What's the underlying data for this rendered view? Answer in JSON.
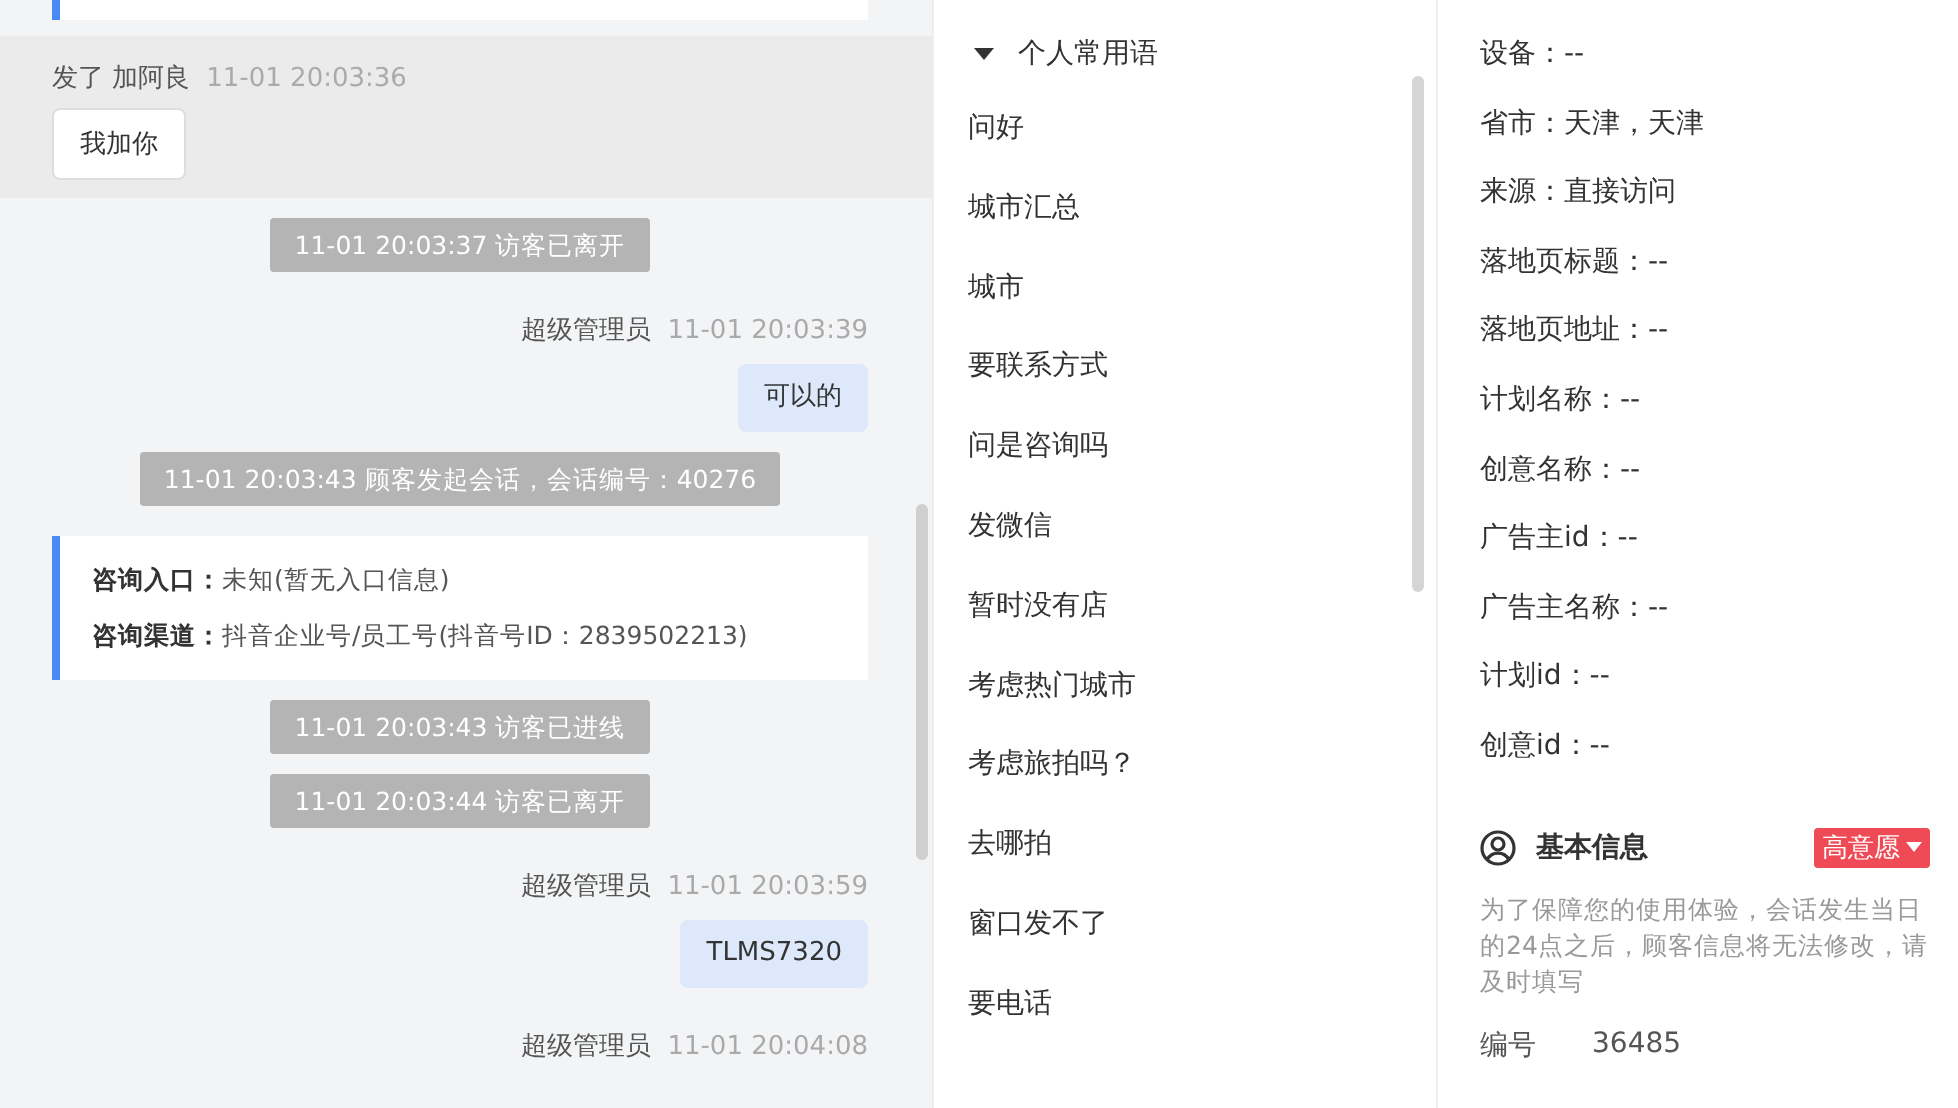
{
  "chat": {
    "messages": [
      {
        "kind": "clipped_card"
      },
      {
        "kind": "highlight",
        "sender": "发了 加阿良",
        "time": "11-01 20:03:36",
        "button": "我加你"
      },
      {
        "kind": "notice",
        "text": "11-01 20:03:37 访客已离开"
      },
      {
        "kind": "outgoing",
        "sender": "超级管理员",
        "time": "11-01 20:03:39",
        "text": "可以的"
      },
      {
        "kind": "notice",
        "text": "11-01 20:03:43 顾客发起会话，会话编号：40276"
      },
      {
        "kind": "info_card",
        "lines": [
          {
            "label": "咨询入口：",
            "value": "未知(暂无入口信息)"
          },
          {
            "label": "咨询渠道：",
            "value": "抖音企业号/员工号(抖音号ID：2839502213)"
          }
        ]
      },
      {
        "kind": "notice",
        "text": "11-01 20:03:43 访客已进线"
      },
      {
        "kind": "notice",
        "text": "11-01 20:03:44 访客已离开"
      },
      {
        "kind": "outgoing",
        "sender": "超级管理员",
        "time": "11-01 20:03:59",
        "text": "TLMS7320"
      },
      {
        "kind": "outgoing",
        "sender": "超级管理员",
        "time": "11-01 20:04:08"
      }
    ]
  },
  "phrases": {
    "title": "个人常用语",
    "expanded": true,
    "items": [
      "问好",
      "城市汇总",
      "城市",
      "要联系方式",
      "问是咨询吗",
      "发微信",
      "暂时没有店",
      "考虑热门城市",
      "考虑旅拍吗？",
      "去哪拍",
      "窗口发不了",
      "要电话"
    ]
  },
  "visitor_info": {
    "lines": [
      "设备：--",
      "省市：天津，天津",
      "来源：直接访问",
      "落地页标题：--",
      "落地页地址：--",
      "计划名称：--",
      "创意名称：--",
      "广告主id：--",
      "广告主名称：--",
      "计划id：--",
      "创意id：--"
    ]
  },
  "basic_info": {
    "title": "基本信息",
    "intent": "高意愿",
    "note": "为了保障您的使用体验，会话发生当日的24点之后，顾客信息将无法修改，请及时填写",
    "fields": [
      {
        "label": "编号",
        "value": "36485"
      }
    ]
  }
}
